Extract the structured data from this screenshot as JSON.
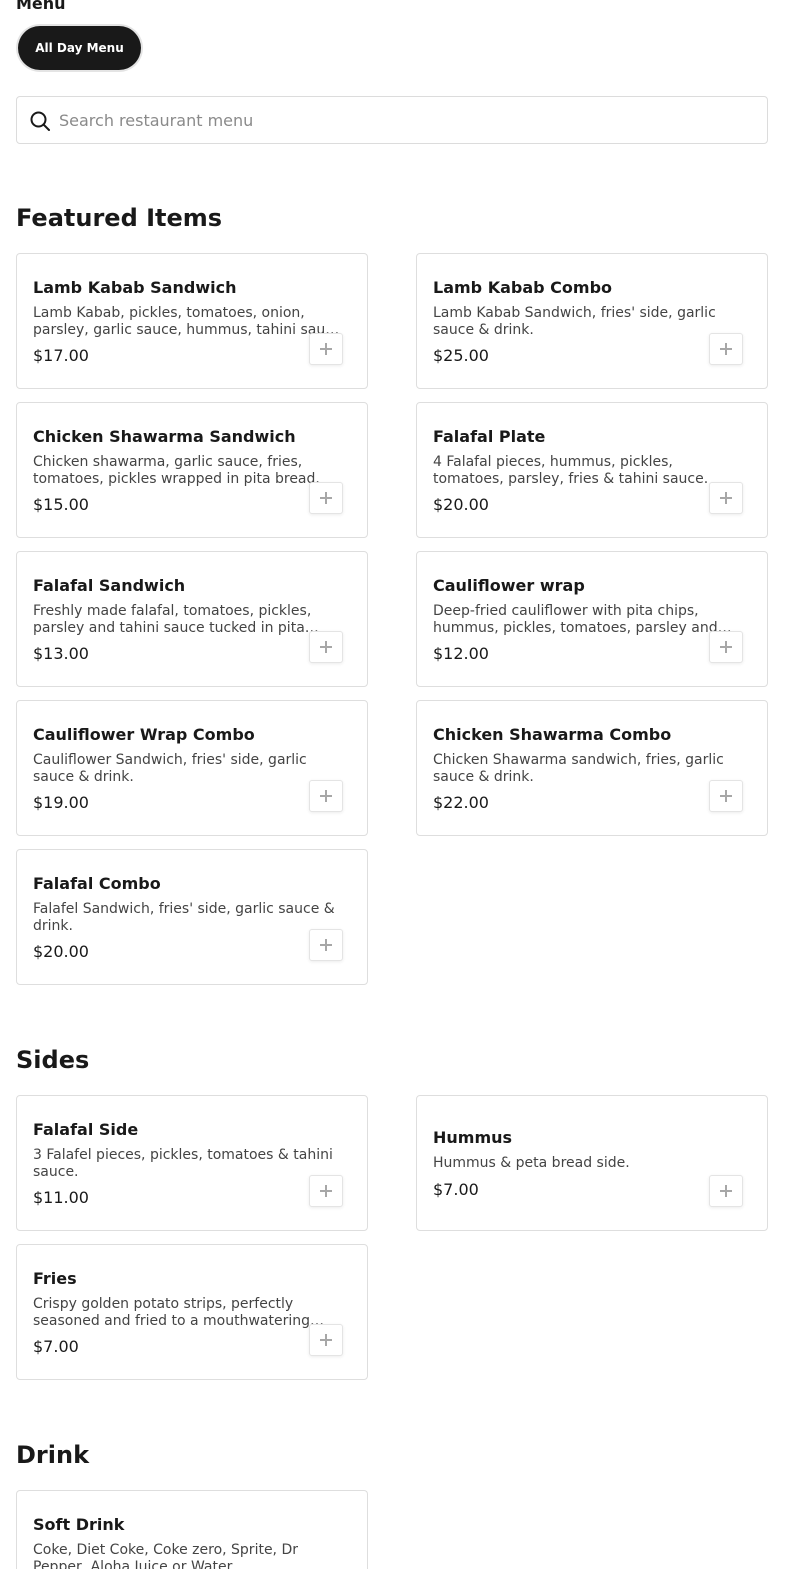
{
  "menu": {
    "label": "Menu",
    "active_menu": "All Day Menu"
  },
  "search": {
    "placeholder": "Search restaurant menu"
  },
  "sections": {
    "featured": {
      "title": "Featured Items",
      "items": [
        {
          "name": "Lamb Kabab Sandwich",
          "description": "Lamb Kabab, pickles, tomatoes, onion, parsley, garlic sauce, hummus, tahini sauce wrapped in pita bread.",
          "price": "$17.00"
        },
        {
          "name": "Lamb Kabab Combo",
          "description": "Lamb Kabab Sandwich, fries' side, garlic sauce & drink.",
          "price": "$25.00"
        },
        {
          "name": "Chicken Shawarma Sandwich",
          "description": "Chicken shawarma, garlic sauce, fries, tomatoes, pickles wrapped in pita bread.",
          "price": "$15.00"
        },
        {
          "name": "Falafal Plate",
          "description": "4 Falafal pieces, hummus, pickles, tomatoes, parsley, fries & tahini sauce.",
          "price": "$20.00"
        },
        {
          "name": "Falafal Sandwich",
          "description": "Freshly made falafal, tomatoes, pickles, parsley and tahini sauce tucked in pita bread.",
          "price": "$13.00"
        },
        {
          "name": "Cauliflower wrap",
          "description": "Deep-fried cauliflower with pita chips, hummus, pickles, tomatoes, parsley and tahini sauce.",
          "price": "$12.00"
        },
        {
          "name": "Cauliflower Wrap Combo",
          "description": "Cauliflower Sandwich, fries' side, garlic sauce & drink.",
          "price": "$19.00"
        },
        {
          "name": "Chicken Shawarma Combo",
          "description": "Chicken Shawarma sandwich, fries, garlic sauce & drink.",
          "price": "$22.00"
        },
        {
          "name": "Falafal Combo",
          "description": "Falafel Sandwich, fries' side, garlic sauce & drink.",
          "price": "$20.00"
        }
      ]
    },
    "sides": {
      "title": "Sides",
      "items": [
        {
          "name": "Falafal Side",
          "description": "3 Falafel pieces, pickles, tomatoes & tahini sauce.",
          "price": "$11.00"
        },
        {
          "name": "Hummus",
          "description": "Hummus & peta bread side.",
          "price": "$7.00"
        },
        {
          "name": "Fries",
          "description": "Crispy golden potato strips, perfectly seasoned and fried to a mouthwatering crunch.",
          "price": "$7.00"
        }
      ]
    },
    "drink": {
      "title": "Drink",
      "items": [
        {
          "name": "Soft Drink",
          "description": "Coke, Diet Coke, Coke zero, Sprite, Dr Pepper, Aloha Juice or Water.",
          "price": ""
        }
      ]
    }
  }
}
